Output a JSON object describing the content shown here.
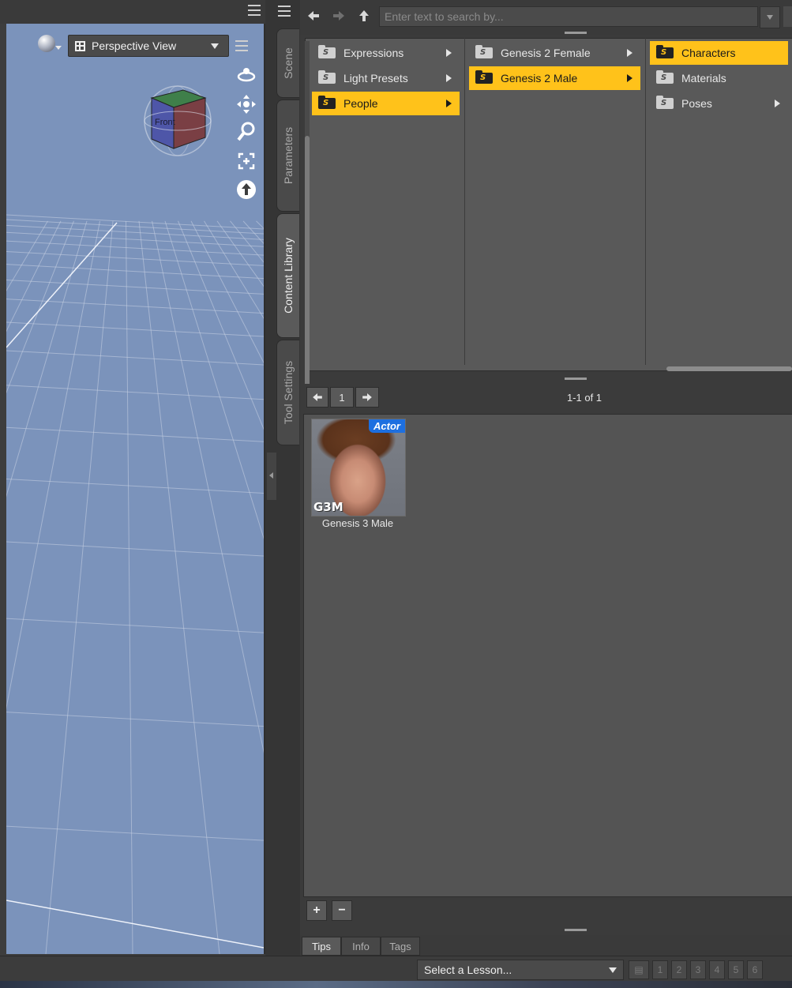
{
  "viewport": {
    "view_label": "Perspective View",
    "cube_face": "Front",
    "nav_icons": [
      "orbit-icon",
      "pan-icon",
      "zoom-icon",
      "frame-icon",
      "reset-icon"
    ]
  },
  "dock_tabs": [
    {
      "label": "Scene",
      "active": false
    },
    {
      "label": "Parameters",
      "active": false
    },
    {
      "label": "Content Library",
      "active": true
    },
    {
      "label": "Tool Settings",
      "active": false
    }
  ],
  "library": {
    "search_placeholder": "Enter text to search by...",
    "columns": [
      [
        {
          "label": "Expressions",
          "selected": false,
          "has_children": true
        },
        {
          "label": "Light Presets",
          "selected": false,
          "has_children": true
        },
        {
          "label": "People",
          "selected": true,
          "has_children": true
        }
      ],
      [
        {
          "label": "Genesis 2 Female",
          "selected": false,
          "has_children": true
        },
        {
          "label": "Genesis 2 Male",
          "selected": true,
          "has_children": true
        }
      ],
      [
        {
          "label": "Characters",
          "selected": true,
          "has_children": false
        },
        {
          "label": "Materials",
          "selected": false,
          "has_children": false
        },
        {
          "label": "Poses",
          "selected": false,
          "has_children": true
        }
      ]
    ],
    "page_number": "1",
    "page_count": "1-1 of 1",
    "results": [
      {
        "label": "Genesis 3 Male",
        "badge": "Actor",
        "overlay": "G3M"
      }
    ],
    "bottom_tabs": [
      "Tips",
      "Info",
      "Tags"
    ],
    "add_label": "+",
    "remove_label": "−"
  },
  "status": {
    "lesson_placeholder": "Select a Lesson...",
    "steps": [
      "1",
      "2",
      "3",
      "4",
      "5",
      "6"
    ]
  },
  "colors": {
    "accent": "#ffc21a",
    "viewport_bg": "#7b93bb",
    "badge": "#1d6fe0"
  }
}
